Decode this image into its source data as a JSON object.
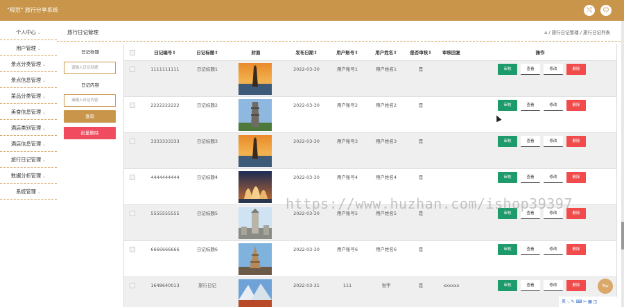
{
  "header": {
    "title": "\"规范\" 旅行分享系统",
    "icons": [
      "shuffle-icon",
      "user-icon"
    ]
  },
  "sidebar": {
    "items": [
      {
        "label": "个人中心"
      },
      {
        "label": "用户管理"
      },
      {
        "label": "景点分类管理"
      },
      {
        "label": "景点信息管理"
      },
      {
        "label": "菜品分类管理"
      },
      {
        "label": "美食信息管理"
      },
      {
        "label": "酒店类别管理"
      },
      {
        "label": "酒店信息管理"
      },
      {
        "label": "旅行日记管理"
      },
      {
        "label": "数据分析管理"
      },
      {
        "label": "系统管理"
      }
    ]
  },
  "page": {
    "title": "旅行日记管理",
    "breadcrumb": "/ 旅行日记管理 / 旅行日记列表"
  },
  "filter": {
    "title_label": "日记标题",
    "title_placeholder": "请输入日记标题",
    "content_label": "日记内容",
    "content_placeholder": "请输入日记内容",
    "search_button": "查询",
    "batch_delete_button": "批量删除"
  },
  "table": {
    "headers": [
      "日记编号⇕",
      "日记标题⇕",
      "封面",
      "发布日期⇕",
      "用户账号⇕",
      "用户姓名⇕",
      "是否审核⇕",
      "审核回复",
      "操作"
    ],
    "actions": {
      "audit": "审核",
      "view": "查看",
      "edit": "修改",
      "delete": "删除"
    },
    "rows": [
      {
        "id": "1111111111",
        "title": "日记标题1",
        "date": "2022-03-30",
        "account": "用户账号1",
        "name": "用户姓名1",
        "audited": "是",
        "reply": "",
        "cover": "sunset-tower"
      },
      {
        "id": "2222222222",
        "title": "日记标题2",
        "date": "2022-03-30",
        "account": "用户账号2",
        "name": "用户姓名2",
        "audited": "是",
        "reply": "",
        "cover": "stone-pagoda"
      },
      {
        "id": "3333333333",
        "title": "日记标题3",
        "date": "2022-03-30",
        "account": "用户账号3",
        "name": "用户姓名3",
        "audited": "是",
        "reply": "",
        "cover": "sunset-tower"
      },
      {
        "id": "4444444444",
        "title": "日记标题4",
        "date": "2022-03-30",
        "account": "用户账号4",
        "name": "用户姓名4",
        "audited": "是",
        "reply": "",
        "cover": "sail-building"
      },
      {
        "id": "5555555555",
        "title": "日记标题5",
        "date": "2022-03-30",
        "account": "用户账号5",
        "name": "用户姓名5",
        "audited": "是",
        "reply": "",
        "cover": "city-tower"
      },
      {
        "id": "6666666666",
        "title": "日记标题6",
        "date": "2022-03-30",
        "account": "用户账号6",
        "name": "用户姓名6",
        "audited": "是",
        "reply": "",
        "cover": "temple-pagoda"
      },
      {
        "id": "1648640013",
        "title": "旅行日记",
        "date": "2022-03-31",
        "account": "111",
        "name": "张宇",
        "audited": "是",
        "reply": "xxxxxx",
        "cover": "mountain-lake"
      }
    ]
  },
  "watermark": "https://www.huzhan.com/ishop39397",
  "top_button": "Top",
  "tray": "英 ·, ✎ ⌨ ✂ ▦ ◫",
  "colors": {
    "primary": "#c8954a",
    "audit": "#1d9b6a",
    "delete": "#f14b4b",
    "batch_delete": "#f04b5e"
  }
}
